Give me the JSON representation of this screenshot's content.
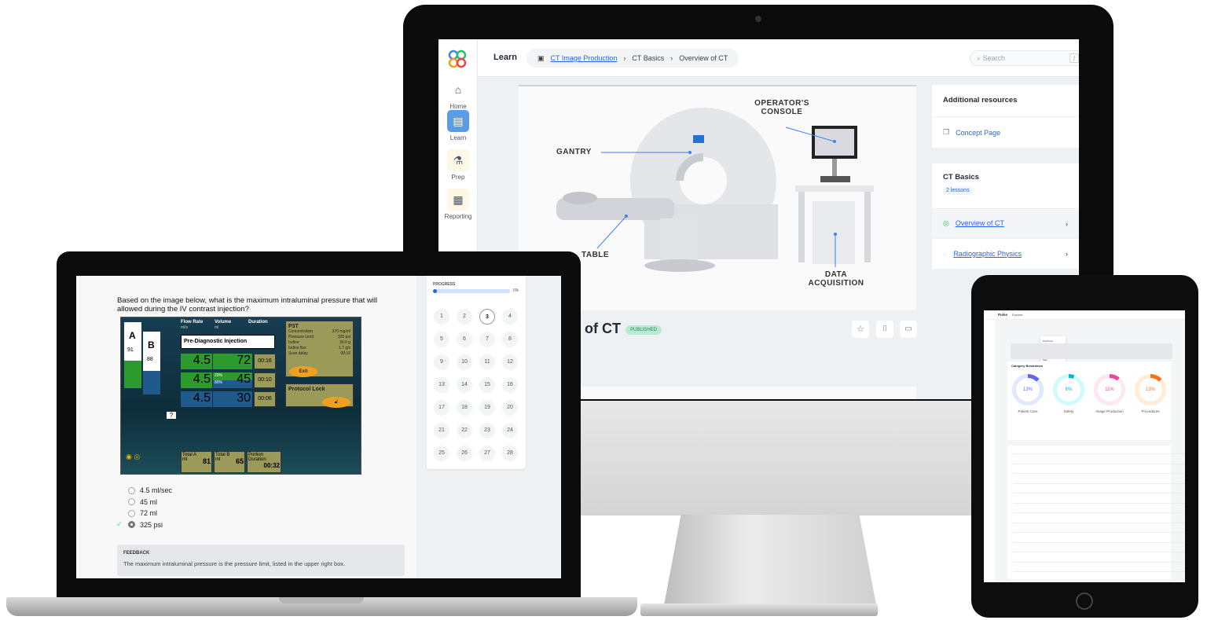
{
  "monitor": {
    "sidebar": [
      {
        "label": "Home",
        "icon": "home-icon"
      },
      {
        "label": "Learn",
        "icon": "book-icon",
        "active": true
      },
      {
        "label": "Prep",
        "icon": "flask-icon"
      },
      {
        "label": "Reporting",
        "icon": "chart-icon"
      }
    ],
    "header": {
      "title": "Learn",
      "breadcrumb": [
        "CT Image Production",
        "CT Basics",
        "Overview of CT"
      ],
      "search_placeholder": "Search",
      "search_shortcut": "/",
      "help": "?"
    },
    "diagram_labels": {
      "console": "OPERATOR'S CONSOLE",
      "gantry": "GANTRY",
      "table": "TABLE",
      "acq": "DATA ACQUISITION"
    },
    "lesson": {
      "title_visible": "of CT",
      "status": "PUBLISHED"
    },
    "resources": {
      "title": "Additional resources",
      "concept": "Concept Page"
    },
    "module": {
      "title": "CT Basics",
      "count": "2 lessons",
      "lessons": [
        {
          "name": "Overview of CT",
          "done": true
        },
        {
          "name": "Radiographic Physics",
          "done": false
        }
      ]
    },
    "accent": "#2563eb"
  },
  "laptop": {
    "question": "Based on the image below, what is the maximum intraluminal pressure that will allowed during the IV contrast injection?",
    "injector": {
      "a": "A",
      "b": "B",
      "a_val": "91",
      "b_val": "88",
      "h_flow": "Flow Rate",
      "h_flow_u": "ml/s",
      "h_vol": "Volume",
      "h_vol_u": "ml",
      "h_dur": "Duration",
      "protocol": "Pre-Diagnostic Injection",
      "rows": [
        {
          "flow": "4.5",
          "vol": "72",
          "dur": "00:16"
        },
        {
          "flow": "4.5",
          "vol": "45",
          "dur": "00:10",
          "mix1": "20%",
          "mix2": "80%"
        },
        {
          "flow": "4.5",
          "vol": "30",
          "dur": "00:06"
        }
      ],
      "p3t": "P3T",
      "params": [
        [
          "Concentration",
          "370 mg/ml"
        ],
        [
          "Pressure Limit",
          "325 psi"
        ],
        [
          "Iodine",
          "30.0 g"
        ],
        [
          "Iodine flux",
          "1.7 g/s"
        ],
        [
          "Scan delay",
          "00:16"
        ]
      ],
      "exit": "Exit",
      "lock": "Protocol Lock",
      "total_a": "Total A",
      "total_a_val": "81",
      "total_b": "Total B",
      "total_b_val": "65",
      "ml": "ml",
      "portion": "Portion Duration",
      "portion_val": "00:32",
      "q": "?"
    },
    "options": [
      {
        "label": "4.5 ml/sec"
      },
      {
        "label": "45 ml"
      },
      {
        "label": "72 ml"
      },
      {
        "label": "325 psi",
        "selected": true,
        "correct": true
      }
    ],
    "feedback": {
      "title": "FEEDBACK",
      "text": "The maximum intraluminal pressure is the pressure limit, listed in the upper right box."
    },
    "progress": {
      "label": "PROGRESS",
      "percent": 0,
      "percent_label": "0%",
      "current": 3,
      "questions": [
        "1",
        "2",
        "3",
        "4",
        "5",
        "6",
        "7",
        "8",
        "9",
        "10",
        "11",
        "12",
        "13",
        "14",
        "15",
        "16",
        "17",
        "18",
        "19",
        "20",
        "21",
        "22",
        "23",
        "24",
        "25",
        "26",
        "27",
        "28"
      ]
    }
  },
  "tablet": {
    "header": {
      "title": "Pulse",
      "tab": "Explore"
    },
    "menu": [
      "Pie/Donut",
      "Details",
      "Timeline",
      "Map"
    ],
    "breakdown": {
      "title": "Category Breakdown",
      "items": [
        {
          "label": "Patient Care",
          "value": "13%",
          "color": "#6366f1",
          "bg": "#e0e7ff"
        },
        {
          "label": "Safety",
          "value": "6%",
          "color": "#06b6d4",
          "bg": "#cffafe"
        },
        {
          "label": "Image Production",
          "value": "11%",
          "color": "#ec4899",
          "bg": "#fce7f3"
        },
        {
          "label": "Procedures",
          "value": "13%",
          "color": "#f97316",
          "bg": "#ffedd5"
        }
      ]
    }
  }
}
